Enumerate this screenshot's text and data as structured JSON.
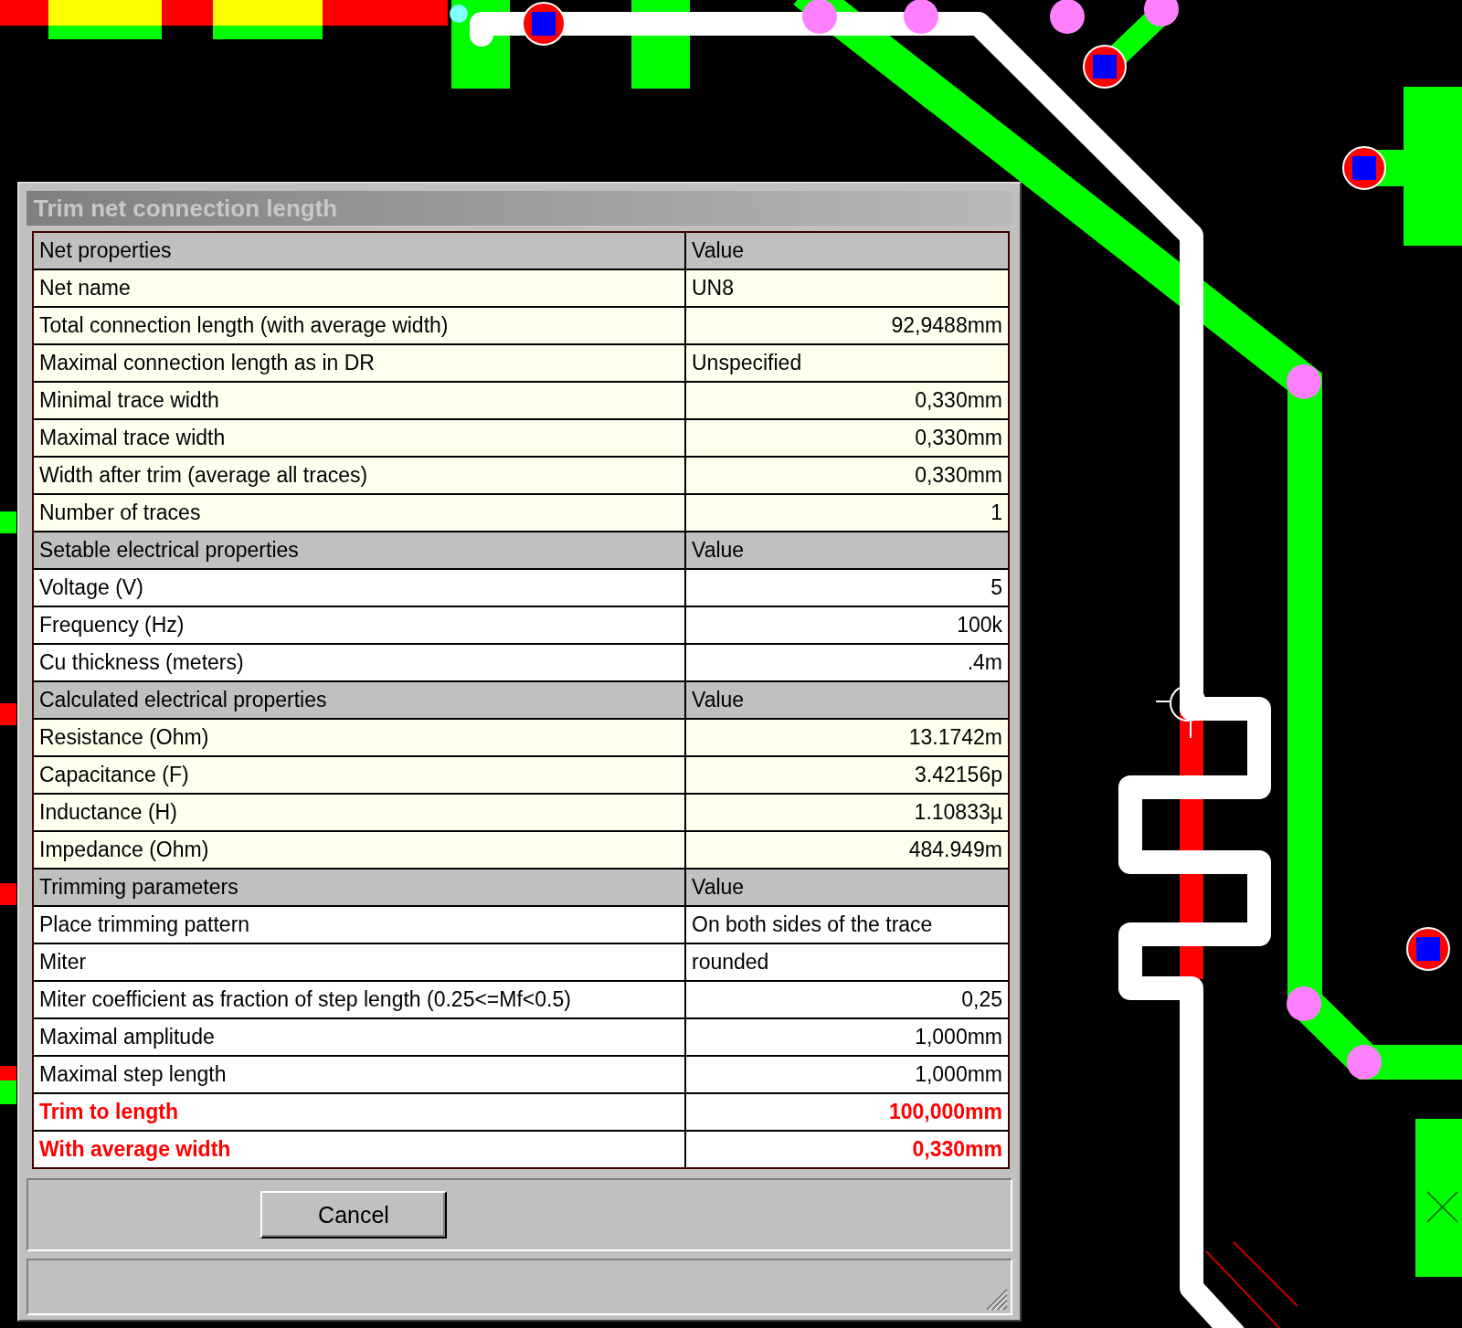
{
  "window": {
    "title": "Trim net connection length"
  },
  "sections": [
    {
      "header": {
        "label": "Net properties",
        "value_label": "Value"
      },
      "shaded": true,
      "rows": [
        {
          "label": "Net name",
          "value": "UN8",
          "kind": "text",
          "emphasis": false
        },
        {
          "label": "Total connection length (with average width)",
          "value": "92,9488mm",
          "kind": "number",
          "emphasis": false
        },
        {
          "label": "Maximal connection length as in DR",
          "value": "Unspecified",
          "kind": "text",
          "emphasis": false
        },
        {
          "label": "Minimal trace width",
          "value": "0,330mm",
          "kind": "number",
          "emphasis": false
        },
        {
          "label": "Maximal trace width",
          "value": "0,330mm",
          "kind": "number",
          "emphasis": false
        },
        {
          "label": "Width after trim (average all traces)",
          "value": "0,330mm",
          "kind": "number",
          "emphasis": false
        },
        {
          "label": "Number of traces",
          "value": "1",
          "kind": "number",
          "emphasis": false
        }
      ]
    },
    {
      "header": {
        "label": "Setable electrical properties",
        "value_label": "Value"
      },
      "shaded": false,
      "rows": [
        {
          "label": "Voltage (V)",
          "value": "5",
          "kind": "number",
          "emphasis": false
        },
        {
          "label": "Frequency (Hz)",
          "value": "100k",
          "kind": "number",
          "emphasis": false
        },
        {
          "label": "Cu thickness (meters)",
          "value": ".4m",
          "kind": "number",
          "emphasis": false
        }
      ]
    },
    {
      "header": {
        "label": "Calculated electrical properties",
        "value_label": "Value"
      },
      "shaded": true,
      "rows": [
        {
          "label": "Resistance (Ohm)",
          "value": "13.1742m",
          "kind": "number",
          "emphasis": false
        },
        {
          "label": "Capacitance (F)",
          "value": "3.42156p",
          "kind": "number",
          "emphasis": false
        },
        {
          "label": "Inductance (H)",
          "value": "1.10833µ",
          "kind": "number",
          "emphasis": false
        },
        {
          "label": "Impedance (Ohm)",
          "value": "484.949m",
          "kind": "number",
          "emphasis": false
        }
      ]
    },
    {
      "header": {
        "label": "Trimming parameters",
        "value_label": "Value"
      },
      "shaded": false,
      "rows": [
        {
          "label": "Place trimming pattern",
          "value": "On both sides of the trace",
          "kind": "text",
          "emphasis": false
        },
        {
          "label": "Miter",
          "value": "rounded",
          "kind": "text",
          "emphasis": false
        },
        {
          "label": "Miter coefficient as fraction of step length (0.25<=Mf<0.5)",
          "value": "0,25",
          "kind": "number",
          "emphasis": false
        },
        {
          "label": "Maximal amplitude",
          "value": "1,000mm",
          "kind": "number",
          "emphasis": false
        },
        {
          "label": "Maximal step length",
          "value": "1,000mm",
          "kind": "number",
          "emphasis": false
        },
        {
          "label": "Trim to length",
          "value": "100,000mm",
          "kind": "number",
          "emphasis": true
        },
        {
          "label": "With average width",
          "value": "0,330mm",
          "kind": "number",
          "emphasis": true
        }
      ]
    }
  ],
  "buttons": [
    {
      "label": "Cancel"
    }
  ]
}
